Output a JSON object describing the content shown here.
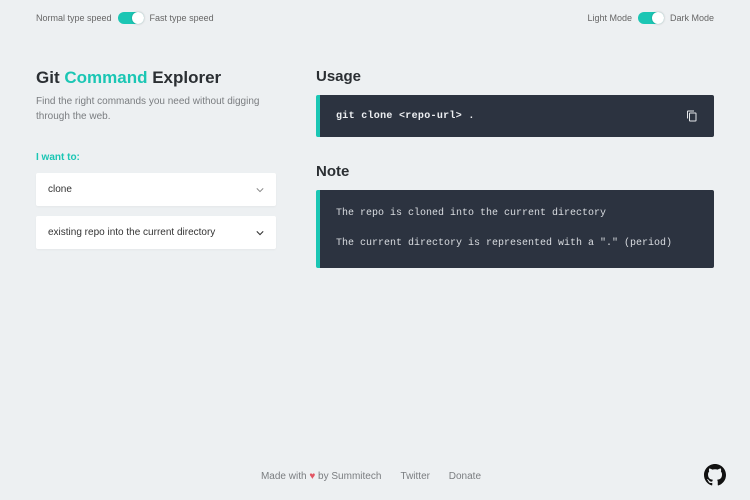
{
  "topbar": {
    "speed_normal": "Normal type speed",
    "speed_fast": "Fast type speed",
    "mode_light": "Light Mode",
    "mode_dark": "Dark Mode"
  },
  "colors": {
    "accent": "#1bc6b4",
    "code_bg": "#2c3340",
    "page_bg": "#edf0f2"
  },
  "title": {
    "word1": "Git",
    "word2": "Command",
    "word3": "Explorer"
  },
  "subtitle": "Find the right commands you need without digging through the web.",
  "prompt": "I want to:",
  "selects": {
    "primary": "clone",
    "secondary": "existing repo into the current directory"
  },
  "usage": {
    "heading": "Usage",
    "command": "git clone <repo-url> ."
  },
  "note": {
    "heading": "Note",
    "line1": "The repo is cloned into the current directory",
    "line2": "The current directory is represented with a \".\" (period)"
  },
  "footer": {
    "made_prefix": "Made with",
    "made_suffix": "by Summitech",
    "twitter": "Twitter",
    "donate": "Donate"
  }
}
